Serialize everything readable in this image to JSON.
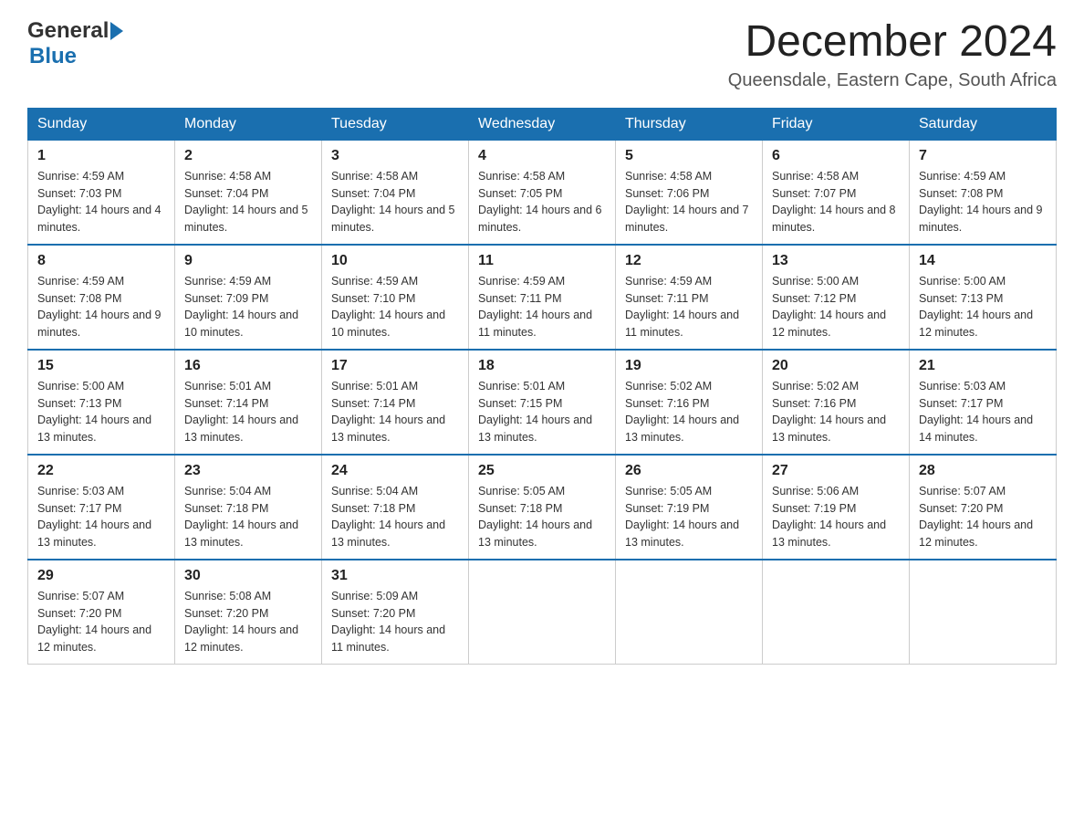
{
  "header": {
    "logo_general": "General",
    "logo_blue": "Blue",
    "month_title": "December 2024",
    "location": "Queensdale, Eastern Cape, South Africa"
  },
  "weekdays": [
    "Sunday",
    "Monday",
    "Tuesday",
    "Wednesday",
    "Thursday",
    "Friday",
    "Saturday"
  ],
  "weeks": [
    [
      {
        "day": "1",
        "sunrise": "4:59 AM",
        "sunset": "7:03 PM",
        "daylight": "14 hours and 4 minutes."
      },
      {
        "day": "2",
        "sunrise": "4:58 AM",
        "sunset": "7:04 PM",
        "daylight": "14 hours and 5 minutes."
      },
      {
        "day": "3",
        "sunrise": "4:58 AM",
        "sunset": "7:04 PM",
        "daylight": "14 hours and 5 minutes."
      },
      {
        "day": "4",
        "sunrise": "4:58 AM",
        "sunset": "7:05 PM",
        "daylight": "14 hours and 6 minutes."
      },
      {
        "day": "5",
        "sunrise": "4:58 AM",
        "sunset": "7:06 PM",
        "daylight": "14 hours and 7 minutes."
      },
      {
        "day": "6",
        "sunrise": "4:58 AM",
        "sunset": "7:07 PM",
        "daylight": "14 hours and 8 minutes."
      },
      {
        "day": "7",
        "sunrise": "4:59 AM",
        "sunset": "7:08 PM",
        "daylight": "14 hours and 9 minutes."
      }
    ],
    [
      {
        "day": "8",
        "sunrise": "4:59 AM",
        "sunset": "7:08 PM",
        "daylight": "14 hours and 9 minutes."
      },
      {
        "day": "9",
        "sunrise": "4:59 AM",
        "sunset": "7:09 PM",
        "daylight": "14 hours and 10 minutes."
      },
      {
        "day": "10",
        "sunrise": "4:59 AM",
        "sunset": "7:10 PM",
        "daylight": "14 hours and 10 minutes."
      },
      {
        "day": "11",
        "sunrise": "4:59 AM",
        "sunset": "7:11 PM",
        "daylight": "14 hours and 11 minutes."
      },
      {
        "day": "12",
        "sunrise": "4:59 AM",
        "sunset": "7:11 PM",
        "daylight": "14 hours and 11 minutes."
      },
      {
        "day": "13",
        "sunrise": "5:00 AM",
        "sunset": "7:12 PM",
        "daylight": "14 hours and 12 minutes."
      },
      {
        "day": "14",
        "sunrise": "5:00 AM",
        "sunset": "7:13 PM",
        "daylight": "14 hours and 12 minutes."
      }
    ],
    [
      {
        "day": "15",
        "sunrise": "5:00 AM",
        "sunset": "7:13 PM",
        "daylight": "14 hours and 13 minutes."
      },
      {
        "day": "16",
        "sunrise": "5:01 AM",
        "sunset": "7:14 PM",
        "daylight": "14 hours and 13 minutes."
      },
      {
        "day": "17",
        "sunrise": "5:01 AM",
        "sunset": "7:14 PM",
        "daylight": "14 hours and 13 minutes."
      },
      {
        "day": "18",
        "sunrise": "5:01 AM",
        "sunset": "7:15 PM",
        "daylight": "14 hours and 13 minutes."
      },
      {
        "day": "19",
        "sunrise": "5:02 AM",
        "sunset": "7:16 PM",
        "daylight": "14 hours and 13 minutes."
      },
      {
        "day": "20",
        "sunrise": "5:02 AM",
        "sunset": "7:16 PM",
        "daylight": "14 hours and 13 minutes."
      },
      {
        "day": "21",
        "sunrise": "5:03 AM",
        "sunset": "7:17 PM",
        "daylight": "14 hours and 14 minutes."
      }
    ],
    [
      {
        "day": "22",
        "sunrise": "5:03 AM",
        "sunset": "7:17 PM",
        "daylight": "14 hours and 13 minutes."
      },
      {
        "day": "23",
        "sunrise": "5:04 AM",
        "sunset": "7:18 PM",
        "daylight": "14 hours and 13 minutes."
      },
      {
        "day": "24",
        "sunrise": "5:04 AM",
        "sunset": "7:18 PM",
        "daylight": "14 hours and 13 minutes."
      },
      {
        "day": "25",
        "sunrise": "5:05 AM",
        "sunset": "7:18 PM",
        "daylight": "14 hours and 13 minutes."
      },
      {
        "day": "26",
        "sunrise": "5:05 AM",
        "sunset": "7:19 PM",
        "daylight": "14 hours and 13 minutes."
      },
      {
        "day": "27",
        "sunrise": "5:06 AM",
        "sunset": "7:19 PM",
        "daylight": "14 hours and 13 minutes."
      },
      {
        "day": "28",
        "sunrise": "5:07 AM",
        "sunset": "7:20 PM",
        "daylight": "14 hours and 12 minutes."
      }
    ],
    [
      {
        "day": "29",
        "sunrise": "5:07 AM",
        "sunset": "7:20 PM",
        "daylight": "14 hours and 12 minutes."
      },
      {
        "day": "30",
        "sunrise": "5:08 AM",
        "sunset": "7:20 PM",
        "daylight": "14 hours and 12 minutes."
      },
      {
        "day": "31",
        "sunrise": "5:09 AM",
        "sunset": "7:20 PM",
        "daylight": "14 hours and 11 minutes."
      },
      null,
      null,
      null,
      null
    ]
  ]
}
